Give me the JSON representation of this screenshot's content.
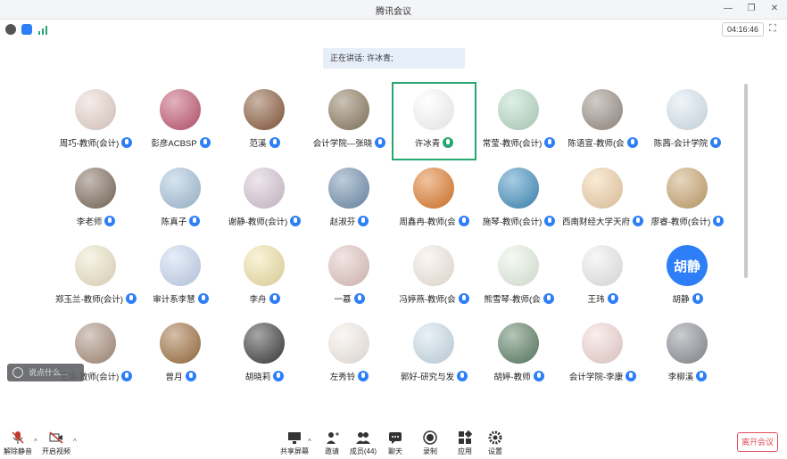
{
  "window": {
    "title": "腾讯会议"
  },
  "info": {
    "timer": "04:16:46"
  },
  "speaking": {
    "text": "正在讲话: 许冰青;"
  },
  "participants": [
    {
      "name": "周巧-教师(会计)",
      "color": "#e9d6cf"
    },
    {
      "name": "彭彦ACBSP",
      "color": "#c25470"
    },
    {
      "name": "范溪",
      "color": "#8a5a3a"
    },
    {
      "name": "会计学院—张晓",
      "color": "#8b7a5e"
    },
    {
      "name": "许冰青",
      "color": "#ffffff",
      "active": true
    },
    {
      "name": "常莹-教师(会计)",
      "color": "#b8dcc7"
    },
    {
      "name": "陈语宣-教师(会",
      "color": "#9a8f86"
    },
    {
      "name": "陈茜-会计学院",
      "color": "#dce9f3"
    },
    {
      "name": "李老师",
      "color": "#7d6b5c"
    },
    {
      "name": "陈真子",
      "color": "#a7c3dc"
    },
    {
      "name": "谢静-教师(会计)",
      "color": "#d8c7d6"
    },
    {
      "name": "赵淑芬",
      "color": "#6f8fae"
    },
    {
      "name": "周鑫冉-教师(会",
      "color": "#e07a2a"
    },
    {
      "name": "施琴-教师(会计)",
      "color": "#3f8fc0"
    },
    {
      "name": "西南财经大学天府",
      "color": "#f3d2a7"
    },
    {
      "name": "廖睿-教师(会计)",
      "color": "#c9a56e"
    },
    {
      "name": "郑玉兰-教师(会计)",
      "color": "#f0e6c9"
    },
    {
      "name": "审计系李慧",
      "color": "#c8d8f2"
    },
    {
      "name": "李舟",
      "color": "#f3e5a8"
    },
    {
      "name": "一慕",
      "color": "#e2c6c0"
    },
    {
      "name": "冯婷燕-教师(会",
      "color": "#f7ede4"
    },
    {
      "name": "熊雪琴-教师(会",
      "color": "#e9f4e6"
    },
    {
      "name": "王玮",
      "color": "#eeeeee"
    },
    {
      "name": "胡静",
      "color": "#2d7ef7",
      "initials": "胡静"
    },
    {
      "name": "王渝-教师(会计)",
      "color": "#a98f7c"
    },
    {
      "name": "曾月",
      "color": "#a0703f"
    },
    {
      "name": "胡晓莉",
      "color": "#3b3b3b"
    },
    {
      "name": "左秀铃",
      "color": "#f6efe9"
    },
    {
      "name": "郭好-研究与发",
      "color": "#cfe0ec"
    },
    {
      "name": "胡婷-教师",
      "color": "#5b7f63"
    },
    {
      "name": "会计学院-李康",
      "color": "#f3d9d5"
    },
    {
      "name": "李柳溪",
      "color": "#8a8f95"
    }
  ],
  "chat": {
    "placeholder": "说点什么..."
  },
  "toolbar": {
    "unmute": "解除静音",
    "video": "开启视频",
    "share": "共享屏幕",
    "invite": "邀请",
    "members": "成员(44)",
    "chat": "聊天",
    "record": "录制",
    "apps": "应用",
    "settings": "设置",
    "leave": "离开会议"
  },
  "colors": {
    "accent": "#2d7ef7",
    "active_border": "#27a770",
    "danger": "#e34d59"
  }
}
